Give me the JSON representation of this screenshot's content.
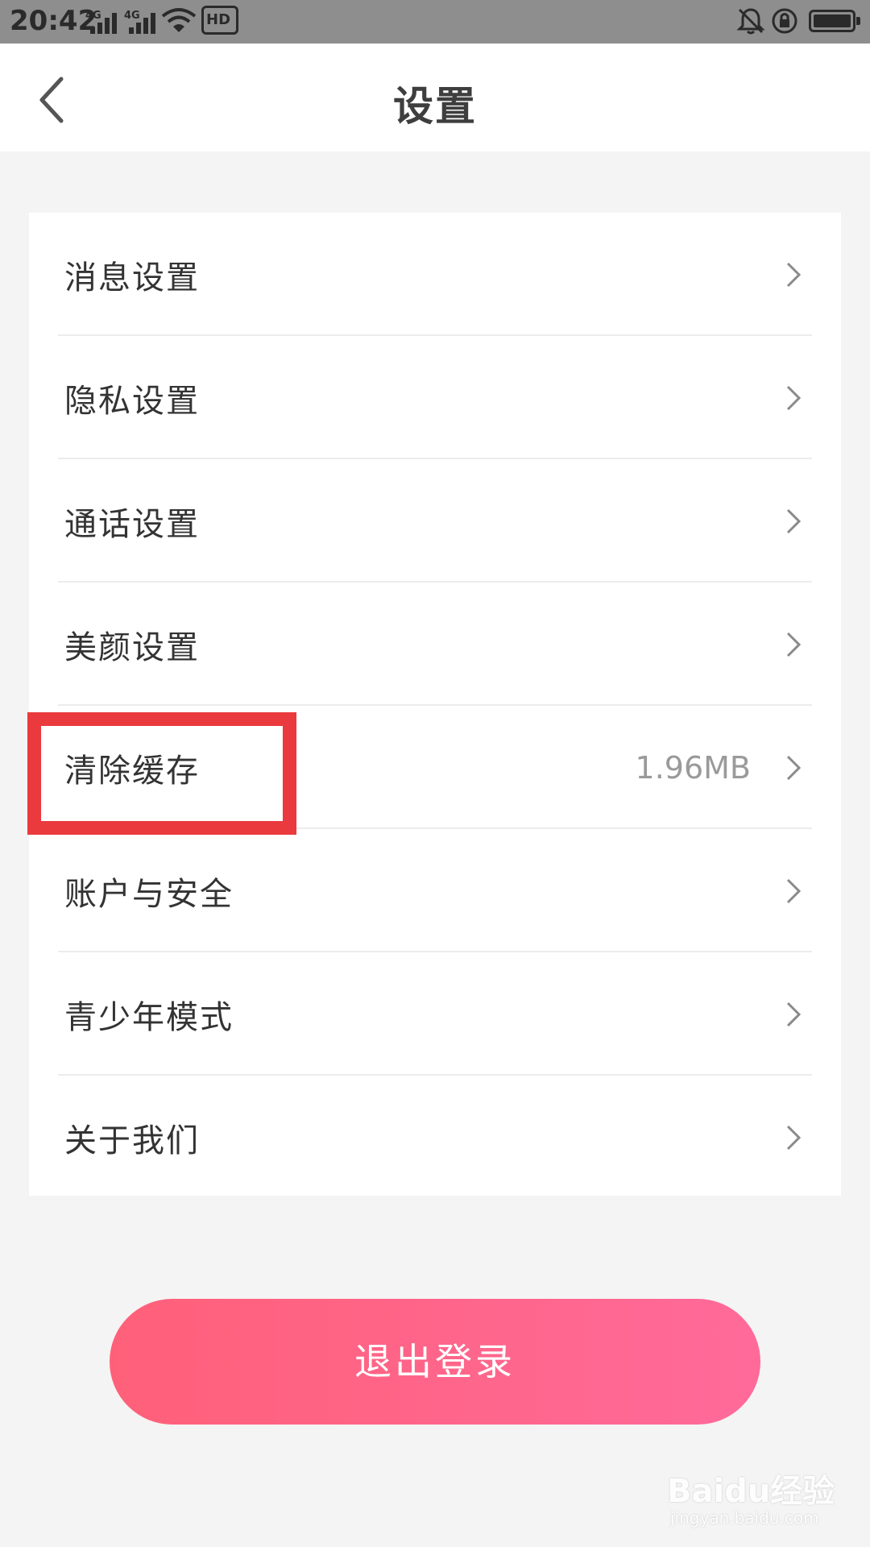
{
  "status_bar": {
    "time": "20:42",
    "network_1": "4G",
    "network_2": "4G",
    "hd_badge": "HD",
    "icons": [
      "signal-icon",
      "signal-icon",
      "wifi-icon",
      "hd-icon",
      "mute-bell-icon",
      "rotation-lock-icon",
      "battery-icon"
    ]
  },
  "header": {
    "title": "设置",
    "back_icon": "chevron-left-icon"
  },
  "settings": {
    "items": [
      {
        "label": "消息设置",
        "value": ""
      },
      {
        "label": "隐私设置",
        "value": ""
      },
      {
        "label": "通话设置",
        "value": ""
      },
      {
        "label": "美颜设置",
        "value": ""
      },
      {
        "label": "清除缓存",
        "value": "1.96MB"
      },
      {
        "label": "账户与安全",
        "value": ""
      },
      {
        "label": "青少年模式",
        "value": ""
      },
      {
        "label": "关于我们",
        "value": ""
      }
    ]
  },
  "logout": {
    "label": "退出登录"
  },
  "watermark": {
    "logo": "Baidu经验",
    "url": "jingyan.baidu.com"
  },
  "colors": {
    "accent_gradient_start": "#ff6079",
    "accent_gradient_end": "#ff6a9a",
    "highlight": "#ea3a3e",
    "background": "#f4f4f4"
  }
}
